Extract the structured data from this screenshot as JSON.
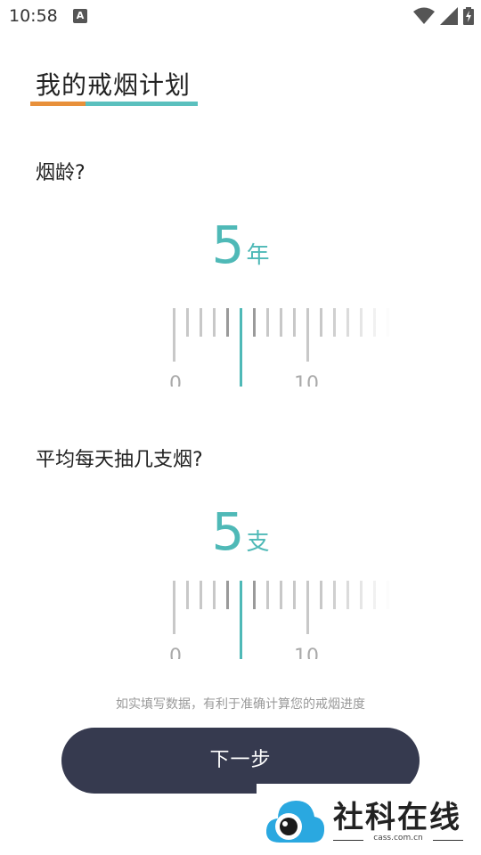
{
  "status": {
    "time": "10:58",
    "notification_icon_letter": "A"
  },
  "title": "我的戒烟计划",
  "q1": {
    "label": "烟龄?",
    "value": "5",
    "unit": "年"
  },
  "q2": {
    "label": "平均每天抽几支烟?",
    "value": "5",
    "unit": "支"
  },
  "hint": "如实填写数据，有利于准确计算您的戒烟进度",
  "next_label": "下一步",
  "watermark": {
    "text": "社科在线",
    "sub": "cass.com.cn"
  },
  "colors": {
    "accent": "#4fb9b7",
    "orange": "#e8903a",
    "button": "#363a4f"
  },
  "icons": [
    "wifi-icon",
    "signal-icon",
    "battery-icon"
  ]
}
